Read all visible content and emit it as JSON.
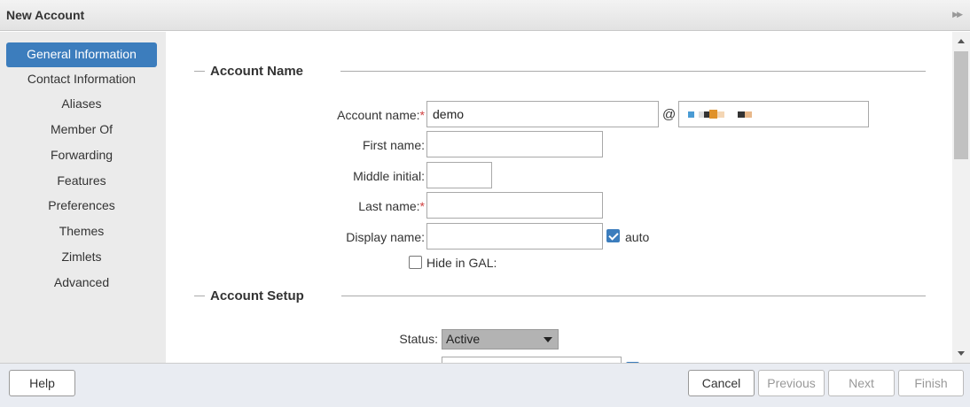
{
  "window": {
    "title": "New Account"
  },
  "sidebar": {
    "items": [
      {
        "label": "General Information",
        "active": true
      },
      {
        "label": "Contact Information"
      },
      {
        "label": "Aliases"
      },
      {
        "label": "Member Of"
      },
      {
        "label": "Forwarding"
      },
      {
        "label": "Features"
      },
      {
        "label": "Preferences"
      },
      {
        "label": "Themes"
      },
      {
        "label": "Zimlets"
      },
      {
        "label": "Advanced"
      }
    ]
  },
  "account_name": {
    "heading": "Account Name",
    "account_name_label": "Account name:",
    "account_name_value": "demo",
    "at": "@",
    "first_name_label": "First name:",
    "first_name_value": "",
    "middle_initial_label": "Middle initial:",
    "middle_initial_value": "",
    "last_name_label": "Last name:",
    "last_name_value": "",
    "display_name_label": "Display name:",
    "display_name_value": "",
    "auto_label": "auto",
    "auto_checked": true,
    "hide_gal_label": "Hide in GAL:",
    "hide_gal_checked": false,
    "required_mark": "*"
  },
  "account_setup": {
    "heading": "Account Setup",
    "status_label": "Status:",
    "status_value": "Active"
  },
  "footer": {
    "help": "Help",
    "cancel": "Cancel",
    "previous": "Previous",
    "next": "Next",
    "finish": "Finish"
  },
  "colors": {
    "accent": "#3c7dbd",
    "required": "#d04040"
  }
}
